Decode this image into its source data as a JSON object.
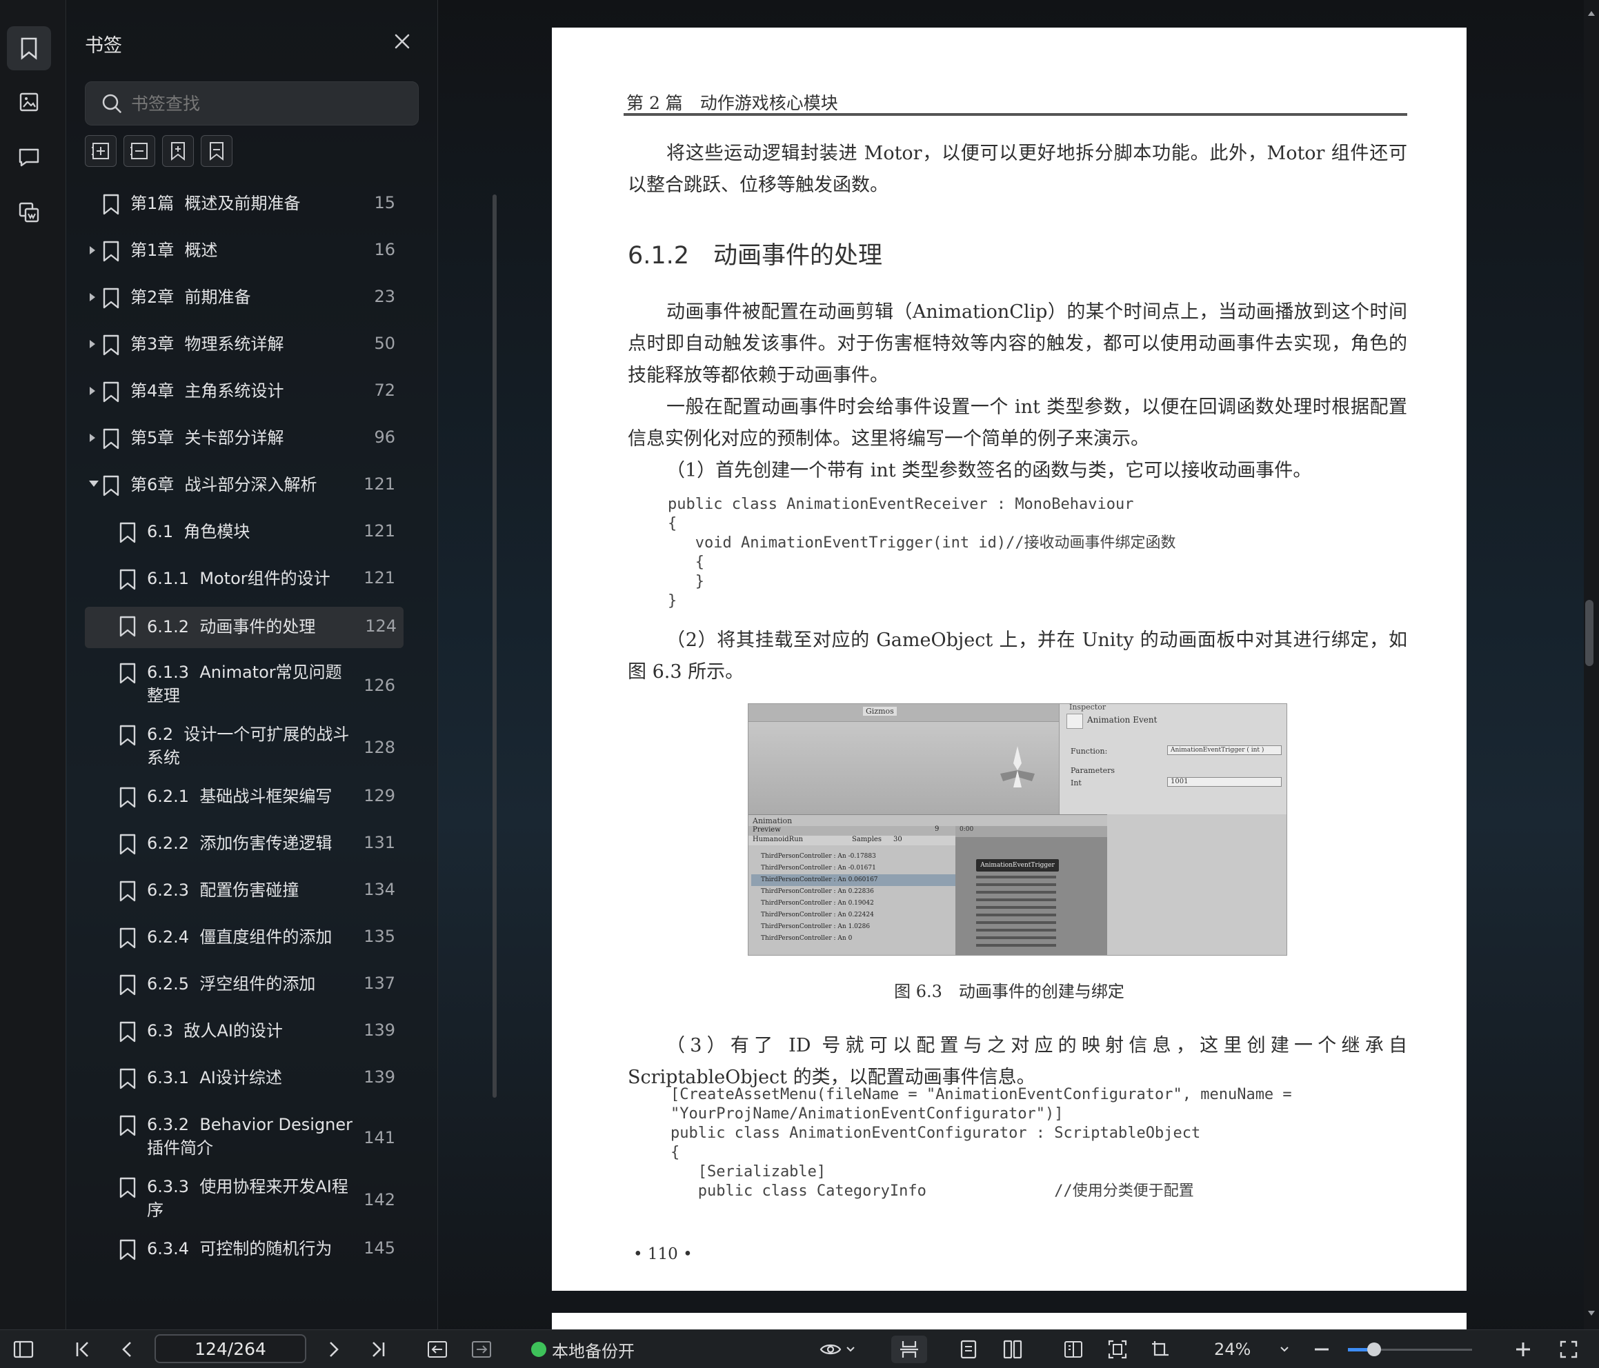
{
  "panel": {
    "title": "书签",
    "search_placeholder": "书签查找"
  },
  "bookmarks": [
    {
      "label": "第1篇  概述及前期准备",
      "page": "15",
      "level": 0,
      "expander": "none"
    },
    {
      "label": "第1章  概述",
      "page": "16",
      "level": 0,
      "expander": "collapsed"
    },
    {
      "label": "第2章  前期准备",
      "page": "23",
      "level": 0,
      "expander": "collapsed"
    },
    {
      "label": "第3章  物理系统详解",
      "page": "50",
      "level": 0,
      "expander": "collapsed"
    },
    {
      "label": "第4章  主角系统设计",
      "page": "72",
      "level": 0,
      "expander": "collapsed"
    },
    {
      "label": "第5章  关卡部分详解",
      "page": "96",
      "level": 0,
      "expander": "collapsed"
    },
    {
      "label": "第6章  战斗部分深入解析",
      "page": "121",
      "level": 0,
      "expander": "expanded"
    },
    {
      "label": "6.1  角色模块",
      "page": "121",
      "level": 1
    },
    {
      "label": "6.1.1  Motor组件的设计",
      "page": "121",
      "level": 1
    },
    {
      "label": "6.1.2  动画事件的处理",
      "page": "124",
      "level": 1,
      "selected": true
    },
    {
      "label": "6.1.3  Animator常见问题整理",
      "page": "126",
      "level": 1
    },
    {
      "label": "6.2  设计一个可扩展的战斗系统",
      "page": "128",
      "level": 1
    },
    {
      "label": "6.2.1  基础战斗框架编写",
      "page": "129",
      "level": 1
    },
    {
      "label": "6.2.2  添加伤害传递逻辑",
      "page": "131",
      "level": 1
    },
    {
      "label": "6.2.3  配置伤害碰撞",
      "page": "134",
      "level": 1
    },
    {
      "label": "6.2.4  僵直度组件的添加",
      "page": "135",
      "level": 1
    },
    {
      "label": "6.2.5  浮空组件的添加",
      "page": "137",
      "level": 1
    },
    {
      "label": "6.3  敌人AI的设计",
      "page": "139",
      "level": 1
    },
    {
      "label": "6.3.1  AI设计综述",
      "page": "139",
      "level": 1
    },
    {
      "label": "6.3.2  Behavior Designer插件简介",
      "page": "141",
      "level": 1
    },
    {
      "label": "6.3.3  使用协程来开发AI程序",
      "page": "142",
      "level": 1
    },
    {
      "label": "6.3.4  可控制的随机行为",
      "page": "145",
      "level": 1
    }
  ],
  "document": {
    "running_head": "第 2 篇　动作游戏核心模块",
    "p1": "将这些运动逻辑封装进 Motor，以便可以更好地拆分脚本功能。此外，Motor 组件还可以整合跳跃、位移等触发函数。",
    "heading": "6.1.2　动画事件的处理",
    "p2": "动画事件被配置在动画剪辑（AnimationClip）的某个时间点上，当动画播放到这个时间点时即自动触发该事件。对于伤害框特效等内容的触发，都可以使用动画事件去实现，角色的技能释放等都依赖于动画事件。",
    "p3": "一般在配置动画事件时会给事件设置一个 int 类型参数，以便在回调函数处理时根据配置信息实例化对应的预制体。这里将编写一个简单的例子来演示。",
    "p4": "（1）首先创建一个带有 int 类型参数签名的函数与类，它可以接收动画事件。",
    "code1": "public class AnimationEventReceiver : MonoBehaviour\n{\n   void AnimationEventTrigger(int id)//接收动画事件绑定函数\n   {\n   }\n}",
    "p5": "（2）将其挂载至对应的 GameObject 上，并在 Unity 的动画面板中对其进行绑定，如图 6.3 所示。",
    "figure": {
      "inspector": "Inspector",
      "event_title": "Animation Event",
      "function_label": "Function:",
      "function_value": "AnimationEventTrigger ( int )",
      "parameters_label": "Parameters",
      "int_label": "Int",
      "int_value": "1001",
      "gizmos": "Gizmos",
      "animation_tab": "Animation",
      "preview": "Preview",
      "clip": "HumanoidRun",
      "samples_label": "Samples",
      "samples_value": "30",
      "time_marker": "0:00",
      "tooltip": "AnimationEventTrigger",
      "tracks": [
        "ThirdPersonController : An -0.17883",
        "ThirdPersonController : An -0.01671",
        "ThirdPersonController : An 0.060167",
        "ThirdPersonController : An 0.22836",
        "ThirdPersonController : An 0.19042",
        "ThirdPersonController : An 0.22424",
        "ThirdPersonController : An 1.0286",
        "ThirdPersonController : An 0"
      ]
    },
    "caption": "图 6.3　动画事件的创建与绑定",
    "p6": "（3）有了 ID 号就可以配置与之对应的映射信息，这里创建一个继承自 ScriptableObject 的类，以配置动画事件信息。",
    "code2": "[CreateAssetMenu(fileName = \"AnimationEventConfigurator\", menuName =\n\"YourProjName/AnimationEventConfigurator\")]\npublic class AnimationEventConfigurator : ScriptableObject\n{\n   [Serializable]\n   public class CategoryInfo              //使用分类便于配置",
    "page_number": "• 110 •"
  },
  "toolbar": {
    "page_indicator": "124/264",
    "backup_status": "本地备份开",
    "zoom": "24%",
    "status_color": "#3ec25a",
    "accent": "#3d8df5"
  }
}
